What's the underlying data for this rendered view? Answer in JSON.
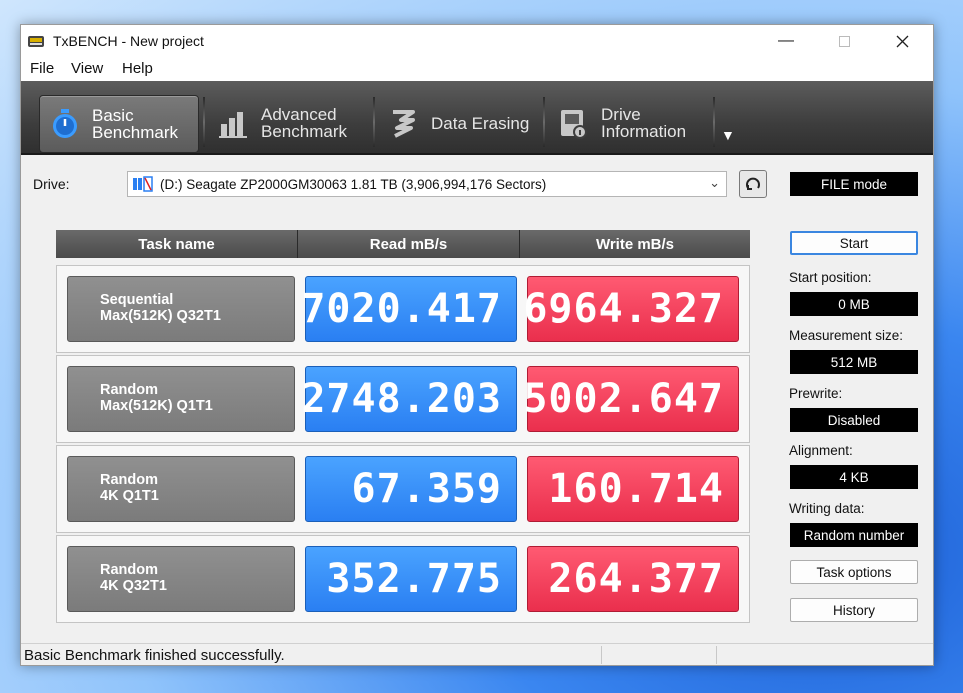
{
  "window": {
    "title": "TxBENCH - New project"
  },
  "menu": [
    "File",
    "View",
    "Help"
  ],
  "toolbar": {
    "tabs": [
      {
        "line1": "Basic",
        "line2": "Benchmark",
        "icon": "stopwatch-icon"
      },
      {
        "line1": "Advanced",
        "line2": "Benchmark",
        "icon": "bar-chart-icon"
      },
      {
        "line1": "Data Erasing",
        "line2": "",
        "icon": "eraser-icon"
      },
      {
        "line1": "Drive",
        "line2": "Information",
        "icon": "drive-info-icon"
      }
    ],
    "active_tab": "Basic Benchmark",
    "more_glyph": "▼"
  },
  "drive": {
    "label": "Drive:",
    "selected": "(D:) Seagate ZP2000GM30063  1.81 TB (3,906,994,176 Sectors)"
  },
  "mode": "FILE mode",
  "table": {
    "headers": [
      "Task name",
      "Read mB/s",
      "Write mB/s"
    ],
    "rows": [
      {
        "name1": "Sequential",
        "name2": "Max(512K) Q32T1",
        "read": "7020.417",
        "write": "6964.327"
      },
      {
        "name1": "Random",
        "name2": "Max(512K) Q1T1",
        "read": "2748.203",
        "write": "5002.647"
      },
      {
        "name1": "Random",
        "name2": "4K Q1T1",
        "read": "67.359",
        "write": "160.714"
      },
      {
        "name1": "Random",
        "name2": "4K Q32T1",
        "read": "352.775",
        "write": "264.377"
      }
    ]
  },
  "settings": {
    "start_label": "Start",
    "start_position_label": "Start position:",
    "start_position": "0 MB",
    "measurement_size_label": "Measurement size:",
    "measurement_size": "512 MB",
    "prewrite_label": "Prewrite:",
    "prewrite": "Disabled",
    "alignment_label": "Alignment:",
    "alignment": "4 KB",
    "writing_data_label": "Writing data:",
    "writing_data": "Random number",
    "task_options_label": "Task options",
    "history_label": "History"
  },
  "status": "Basic Benchmark finished successfully.",
  "colors": {
    "read": "#2a7ff2",
    "write": "#ea2f4d",
    "toolbar": "#3d3d3d"
  }
}
